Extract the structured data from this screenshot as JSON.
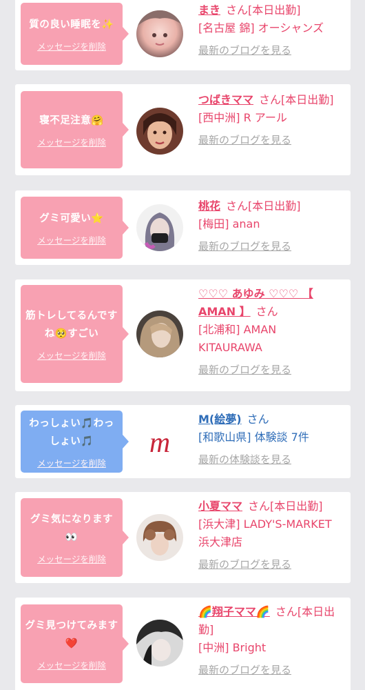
{
  "entries": [
    {
      "message": "質の良い睡眠を✨",
      "delete_label": "メッセージを削除",
      "name": "まき",
      "suffix": "さん[本日出勤]",
      "shop": "[名古屋 錦] オーシャンズ",
      "blog_link": "最新のブログを見る"
    },
    {
      "message": "寝不足注意🤗",
      "delete_label": "メッセージを削除",
      "name": "つばきママ",
      "suffix": "さん[本日出勤]",
      "shop": "[西中洲] R アール",
      "blog_link": "最新のブログを見る"
    },
    {
      "message": "グミ可愛い⭐",
      "delete_label": "メッセージを削除",
      "name": "桃花",
      "suffix": "さん[本日出勤]",
      "shop": "[梅田] anan",
      "blog_link": "最新のブログを見る"
    },
    {
      "message": "筋トレしてるんですね🥺すごい",
      "delete_label": "メッセージを削除",
      "name": "♡♡♡ あゆみ ♡♡♡ 【 AMAN 】",
      "suffix": "さん",
      "shop": "[北浦和] AMAN KITAURAWA",
      "blog_link": "最新のブログを見る"
    },
    {
      "message": "わっしょい🎵わっしょい🎵",
      "delete_label": "メッセージを削除",
      "name": "M(絵夢)",
      "suffix": "さん",
      "shop": "[和歌山県] 体験談 7件",
      "blog_link": "最新の体験談を見る",
      "avatar_letter": "m"
    },
    {
      "message": "グミ気になります👀",
      "delete_label": "メッセージを削除",
      "name": "小夏ママ",
      "suffix": "さん[本日出勤]",
      "shop": "[浜大津] LADY'S-MARKET 浜大津店",
      "blog_link": "最新のブログを見る"
    },
    {
      "message": "グミ見つけてみます❤️",
      "delete_label": "メッセージを削除",
      "name": "🌈翔子ママ🌈",
      "suffix": "さん[本日出勤]",
      "shop": "[中洲] Bright",
      "blog_link": "最新のブログを見る"
    }
  ],
  "colors": {
    "page_background": "#e9e9ec",
    "pink_bubble": "#f8a1b2",
    "blue_bubble": "#7fadf2",
    "pink_text": "#e8456b",
    "blue_text": "#2f6db8",
    "link_gray": "#a6a6a6"
  }
}
